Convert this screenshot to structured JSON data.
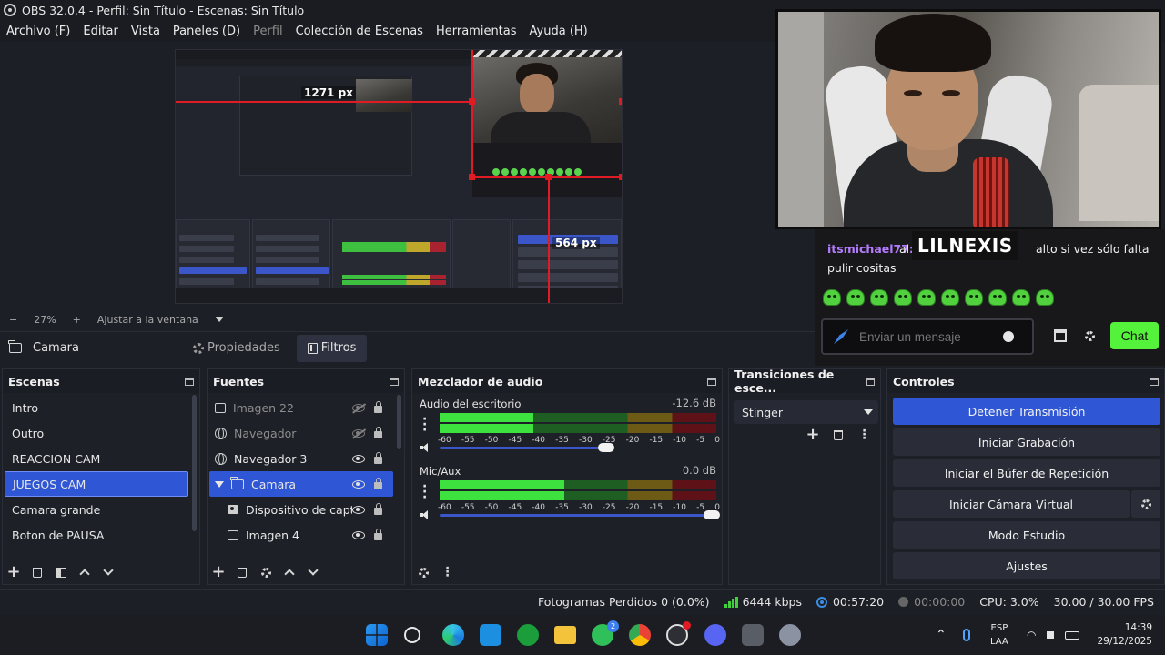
{
  "window": {
    "title": "OBS 32.0.4 - Perfil: Sin Título - Escenas: Sin Título"
  },
  "menu": [
    "Archivo (F)",
    "Editar",
    "Vista",
    "Paneles (D)",
    "Perfil",
    "Colección de Escenas",
    "Herramientas",
    "Ayuda (H)"
  ],
  "preview": {
    "nested_label_width": "1271 px",
    "nested_label_height": "564 px",
    "zoom": "27%",
    "fit_label": "Ajustar a la ventana"
  },
  "context": {
    "source_name": "Camara",
    "properties_label": "Propiedades",
    "filters_label": "Filtros"
  },
  "stream": {
    "chat_username": "itsmichael77:",
    "chat_text_a": "al",
    "chat_text_b": "alto si vez sólo falta",
    "chat_text_c": "pulir cositas",
    "overlay_name": "LILNEXIS",
    "chat_placeholder": "Enviar un mensaje",
    "chat_button": "Chat"
  },
  "scenes": {
    "title": "Escenas",
    "items": [
      "Intro",
      "Outro",
      "REACCION CAM",
      "JUEGOS CAM",
      "Camara grande",
      "Boton de PAUSA"
    ],
    "selected_index": 3
  },
  "sources": {
    "title": "Fuentes",
    "items": [
      {
        "name": "Imagen 22",
        "icon": "image-icon",
        "visible": false
      },
      {
        "name": "Navegador",
        "icon": "globe-icon",
        "visible": false
      },
      {
        "name": "Navegador 3",
        "icon": "globe-icon",
        "visible": true
      },
      {
        "name": "Camara",
        "icon": "folder-icon",
        "visible": true,
        "group": true,
        "selected": true
      },
      {
        "name": "Dispositivo de captura de video",
        "icon": "camera-icon",
        "visible": true
      },
      {
        "name": "Imagen 4",
        "icon": "image-icon",
        "visible": true
      }
    ]
  },
  "mixer": {
    "title": "Mezclador de audio",
    "channels": [
      {
        "name": "Audio del escritorio",
        "db": "-12.6 dB",
        "level": 0.34,
        "volume": 0.62
      },
      {
        "name": "Mic/Aux",
        "db": "0.0 dB",
        "level": 0.45,
        "volume": 1.0
      }
    ],
    "ticks": [
      "-60",
      "-55",
      "-50",
      "-45",
      "-40",
      "-35",
      "-30",
      "-25",
      "-20",
      "-15",
      "-10",
      "-5",
      "0"
    ]
  },
  "transitions": {
    "title": "Transiciones de esce...",
    "selected": "Stinger"
  },
  "controls": {
    "title": "Controles",
    "stop_stream": "Detener Transmisión",
    "start_record": "Iniciar Grabación",
    "replay_buffer": "Iniciar el Búfer de Repetición",
    "virtual_cam": "Iniciar Cámara Virtual",
    "studio_mode": "Modo Estudio",
    "settings": "Ajustes"
  },
  "status": {
    "dropped": "Fotogramas Perdidos 0 (0.0%)",
    "bitrate": "6444 kbps",
    "stream_time": "00:57:20",
    "record_time": "00:00:00",
    "cpu": "CPU: 3.0%",
    "fps": "30.00 / 30.00 FPS"
  },
  "taskbar": {
    "lang_1": "ESP",
    "lang_2": "LAA",
    "time": "14:39",
    "date": "29/12/2025",
    "whatsapp_badge": "2"
  },
  "colors": {
    "accent": "#2f56d4",
    "twitch_green": "#54f23a",
    "live_red": "#e01b24"
  }
}
